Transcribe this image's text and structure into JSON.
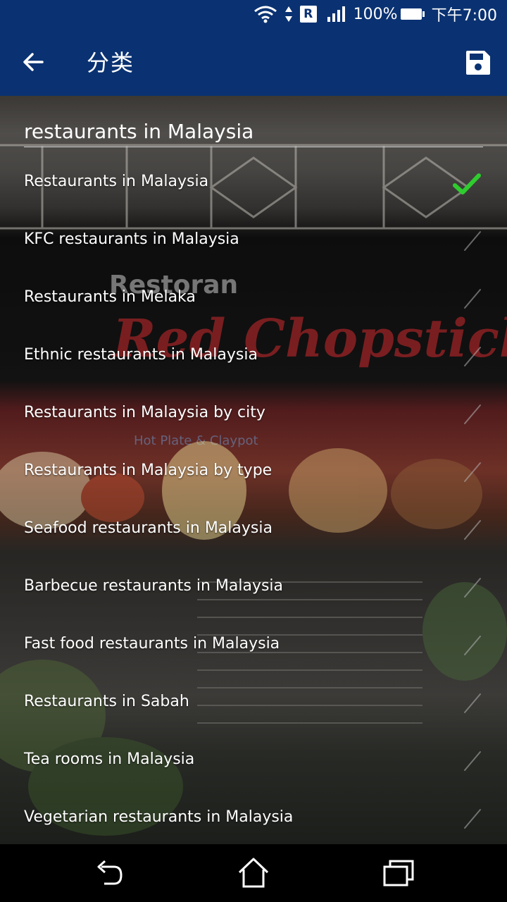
{
  "status_bar": {
    "network_badge": "R",
    "battery_percent": "100%",
    "time": "下午7:00",
    "icons": [
      "wifi-icon",
      "signal-icon",
      "battery-icon"
    ]
  },
  "app_bar": {
    "title": "分类",
    "back_icon": "arrow-left-icon",
    "save_icon": "save-icon"
  },
  "search": {
    "value": "restaurants in Malaysia"
  },
  "results": [
    {
      "label": "Restaurants in Malaysia",
      "checked": true
    },
    {
      "label": "KFC restaurants in Malaysia",
      "checked": false
    },
    {
      "label": "Restaurants in Melaka",
      "checked": false
    },
    {
      "label": "Ethnic restaurants in Malaysia",
      "checked": false
    },
    {
      "label": "Restaurants in Malaysia by city",
      "checked": false
    },
    {
      "label": "Restaurants in Malaysia by type",
      "checked": false
    },
    {
      "label": "Seafood restaurants in Malaysia",
      "checked": false
    },
    {
      "label": "Barbecue restaurants in Malaysia",
      "checked": false
    },
    {
      "label": "Fast food restaurants in Malaysia",
      "checked": false
    },
    {
      "label": "Restaurants in Sabah",
      "checked": false
    },
    {
      "label": "Tea rooms in Malaysia",
      "checked": false
    },
    {
      "label": "Vegetarian restaurants in Malaysia",
      "checked": false
    }
  ],
  "background_sign": {
    "line1": "Restoran",
    "line2": "Red Chopstick",
    "line3": "Hot Plate & Claypot"
  },
  "colors": {
    "app_bar": "#0a3272",
    "check_active": "#2ecc2e",
    "fab": "#1a5fb0"
  }
}
